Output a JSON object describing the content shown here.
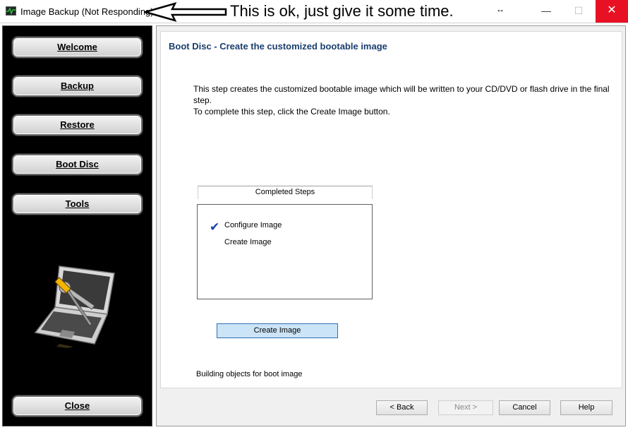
{
  "window": {
    "title": "Image Backup (Not Responding)",
    "annotation": "This is ok, just give it some time.",
    "minimize": "—",
    "maximize": "☐",
    "close": "✕",
    "resize_glyph": "↔"
  },
  "sidebar": {
    "items": [
      {
        "label": "Welcome"
      },
      {
        "label": "Backup"
      },
      {
        "label": "Restore"
      },
      {
        "label": "Boot Disc"
      },
      {
        "label": "Tools"
      }
    ],
    "close_label": "Close"
  },
  "main": {
    "title": "Boot Disc - Create the customized bootable image",
    "description_line1": "This step creates the customized bootable image which will be written to your CD/DVD or flash drive in the final step.",
    "description_line2": "To complete this step, click the Create Image button.",
    "steps_header": "Completed Steps",
    "steps": [
      {
        "label": "Configure Image",
        "completed": true
      },
      {
        "label": "Create Image",
        "completed": false
      }
    ],
    "check_glyph": "✔",
    "create_button": "Create Image",
    "status": "Building objects for boot image"
  },
  "footer": {
    "back": "< Back",
    "next": "Next >",
    "cancel": "Cancel",
    "help": "Help"
  },
  "colors": {
    "title_blue": "#1b3e6e",
    "close_red": "#e81123",
    "create_btn_bg": "#cce4f7",
    "check_blue": "#1a3ea8"
  }
}
